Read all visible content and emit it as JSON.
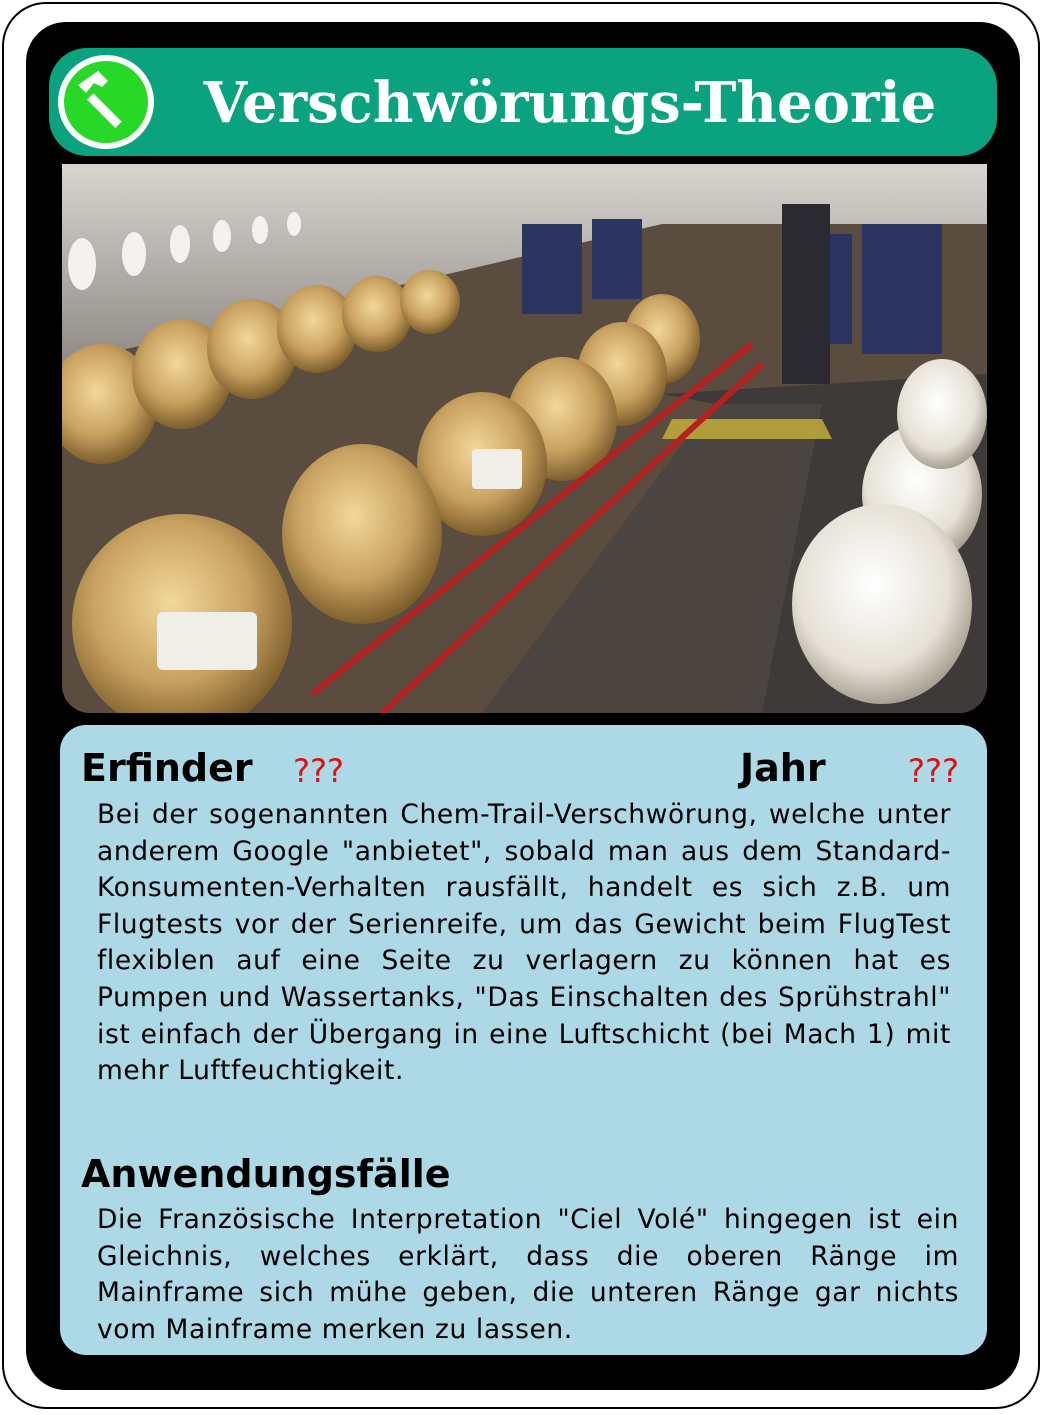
{
  "card": {
    "title": "Verschwörungs-Theorie",
    "icon": "hammer-icon",
    "colors": {
      "header": "#0ba37f",
      "badge": "#27d827",
      "info_bg": "#add8e6",
      "unknown_text": "#e01010"
    },
    "image": "airplane-cabin-water-tanks-photo",
    "inventor_label": "Erfinder",
    "inventor_value": "???",
    "year_label": "Jahr",
    "year_value": "???",
    "description": "Bei der sogenannten Chem-Trail-Verschwörung, welche unter anderem Google \"anbietet\", sobald man aus dem Standard-Konsumenten-Verhalten rausfällt, handelt es sich z.B. um Flugtests vor der Serienreife, um das Gewicht beim FlugTest flexiblen auf eine Seite zu verlagern zu können hat es Pumpen und Wassertanks, \"Das Einschalten des Sprühstrahl\" ist einfach der Übergang in eine Luftschicht (bei Mach 1) mit mehr Luftfeuchtigkeit.",
    "use_cases_label": "Anwendungsfälle",
    "use_cases": "Die Französische Interpretation \"Ciel Volé\" hingegen ist ein Gleichnis, welches erklärt, dass die oberen Ränge im Mainframe sich mühe geben, die unteren Ränge gar nichts vom Mainframe merken zu lassen."
  }
}
